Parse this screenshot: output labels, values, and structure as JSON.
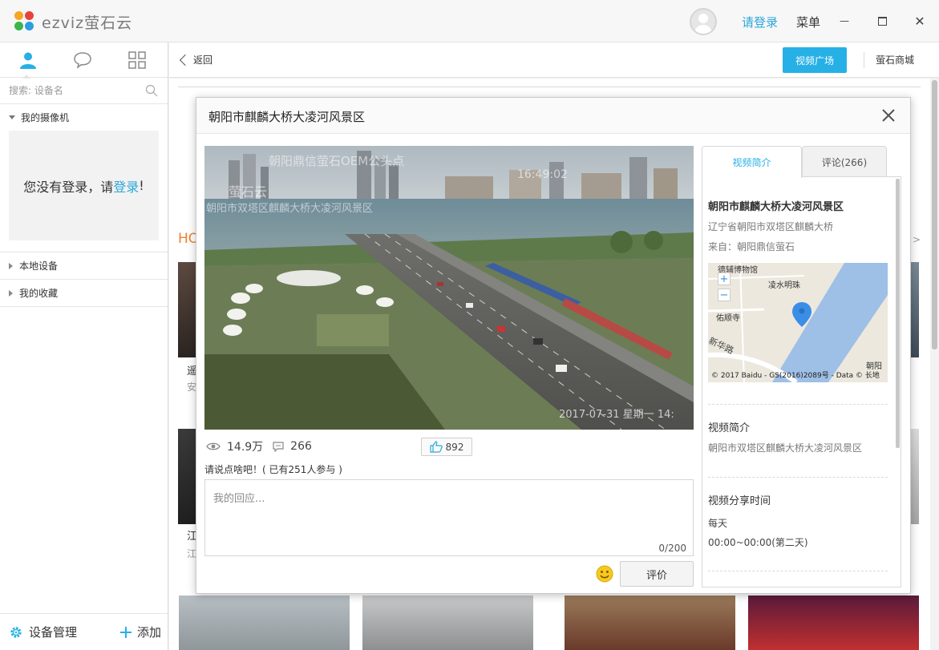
{
  "app": {
    "logo_text": "ezviz萤石云",
    "login_label": "请登录",
    "menu_label": "菜单",
    "minimize_glyph": "—",
    "close_glyph": "✕"
  },
  "sidebar": {
    "search_placeholder": "搜索: 设备名",
    "my_cameras": "我的摄像机",
    "login_hint_prefix": "您没有登录，请",
    "login_hint_link": "登录",
    "login_hint_suffix": "!",
    "local_devices": "本地设备",
    "favorites": "我的收藏",
    "device_manage": "设备管理",
    "add": "添加"
  },
  "topbar": {
    "back": "返回",
    "video_square": "视频广场",
    "mall": "萤石商城"
  },
  "background": {
    "hot_label": "HO",
    "more_glyph": ">",
    "card1_title": "遥",
    "card1_sub": "安",
    "card2_title": "江",
    "card2_sub": "江"
  },
  "modal": {
    "title": "朝阳市麒麟大桥大凌河风景区",
    "watermark_top": "朝阳鼎信萤石OEM公头点",
    "watermark_left": "萤石云",
    "watermark_loc": "朝阳市双塔区麒麟大桥大凌河风景区",
    "watermark_time": "16:49:02",
    "watermark_date": "2017-07-31 星期一 14:",
    "views": "14.9万",
    "comments": "266",
    "likes": "892",
    "prompt": "请说点啥吧！( 已有251人参与 )",
    "reply_placeholder": "我的回应...",
    "char_count": "0/200",
    "rate_button": "评价"
  },
  "info_panel": {
    "tab_intro": "视频简介",
    "tab_comments": "评论(266)",
    "title": "朝阳市麒麟大桥大凌河风景区",
    "address": "辽宁省朝阳市双塔区麒麟大桥",
    "source": "来自：朝阳鼎信萤石",
    "map_labels": [
      "德辅博物馆",
      "凌水明珠",
      "佑顺寺",
      "新华路",
      "朝阳"
    ],
    "map_zoom_in": "+",
    "map_zoom_out": "−",
    "map_copyright": "© 2017 Baidu - GS(2016)2089号 - Data © 长地",
    "intro_heading": "视频简介",
    "intro_text": "朝阳市双塔区麒麟大桥大凌河风景区",
    "share_heading": "视频分享时间",
    "share_day": "每天",
    "share_time": "00:00~00:00(第二天)"
  },
  "colors": {
    "accent": "#26b0e6",
    "link": "#2ba7d8",
    "hot": "#f0802e"
  }
}
